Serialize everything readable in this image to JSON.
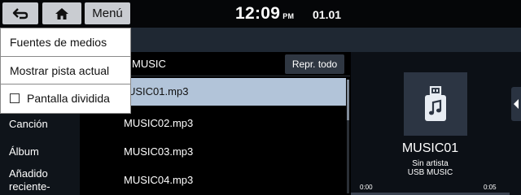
{
  "topbar": {
    "back_icon": "back-arrow-icon",
    "home_icon": "home-icon",
    "menu_label": "Menú",
    "time": "12:09",
    "ampm": "PM",
    "date": "01.01"
  },
  "menu": {
    "items": [
      {
        "label": "Fuentes de medios"
      },
      {
        "label": "Mostrar pista actual"
      },
      {
        "label": "Pantalla dividida",
        "checked": false
      }
    ]
  },
  "categories": [
    "Canción",
    "Álbum",
    "Añadido",
    "reciente-"
  ],
  "list": {
    "folder": "MUSIC",
    "play_all_label": "Repr. todo",
    "files": [
      "MUSIC01.mp3",
      "MUSIC02.mp3",
      "MUSIC03.mp3",
      "MUSIC04.mp3"
    ],
    "selected_index": 0,
    "selected_visible_text": "USIC01.mp3"
  },
  "now_playing": {
    "title": "MUSIC01",
    "artist": "Sin artista",
    "source": "USB MUSIC",
    "elapsed": "0:00",
    "duration": "0:05",
    "progress_fraction": 0,
    "icon": "usb-music-icon"
  },
  "colors": {
    "selected_row": "#b2c4d9",
    "title_strip": "#1f2833",
    "button_bg": "#c9ccd1"
  }
}
